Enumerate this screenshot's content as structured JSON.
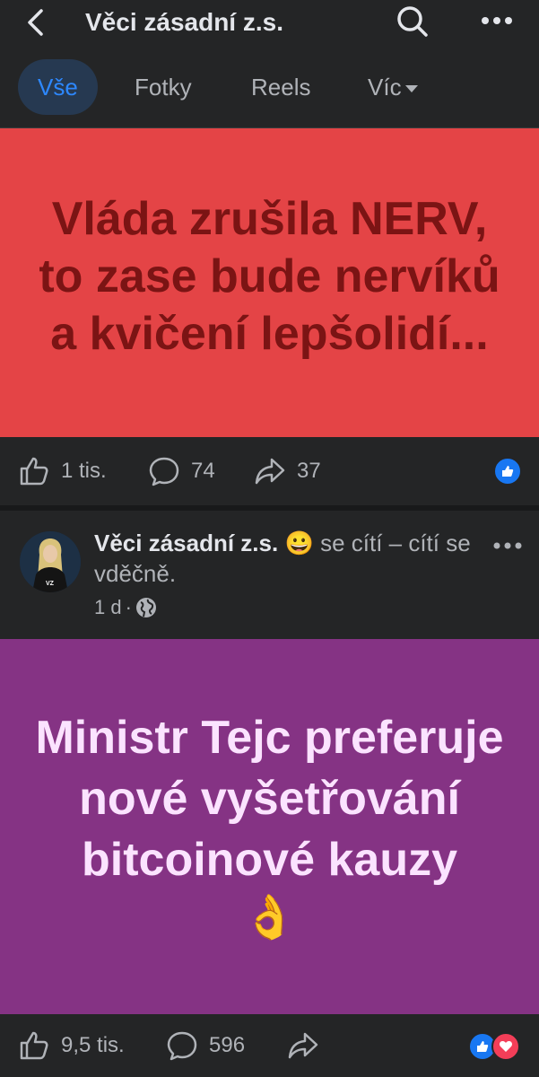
{
  "header": {
    "title": "Věci zásadní z.s.",
    "back_icon": "chevron-left-icon",
    "search_icon": "search-icon",
    "more_icon": "more-horizontal-icon"
  },
  "tabs": [
    {
      "label": "Vše",
      "active": true
    },
    {
      "label": "Fotky",
      "active": false
    },
    {
      "label": "Reels",
      "active": false
    },
    {
      "label": "Víc",
      "active": false
    }
  ],
  "post1": {
    "text": "Vláda zrušila NERV, to zase bude nervíků a kvičení lepšolidí...",
    "background": "#e44446",
    "text_color": "#7b1414",
    "likes": "1 tis.",
    "comments": "74",
    "shares": "37"
  },
  "post2": {
    "author": "Věci zásadní z.s.",
    "feeling_emoji": "😀",
    "feeling_text": "se cítí – cítí se vděčně.",
    "time": "1 d",
    "avatar_label": "VZ",
    "text": "Ministr Tejc preferuje nové vyšetřování bitcoinové kauzy",
    "emoji": "👌",
    "background": "#853384",
    "text_color": "#fbe3ff",
    "likes": "9,5 tis.",
    "comments": "596"
  },
  "colors": {
    "accent": "#2d88ff",
    "like_blue": "#1877f2",
    "love_red": "#f33e58"
  }
}
